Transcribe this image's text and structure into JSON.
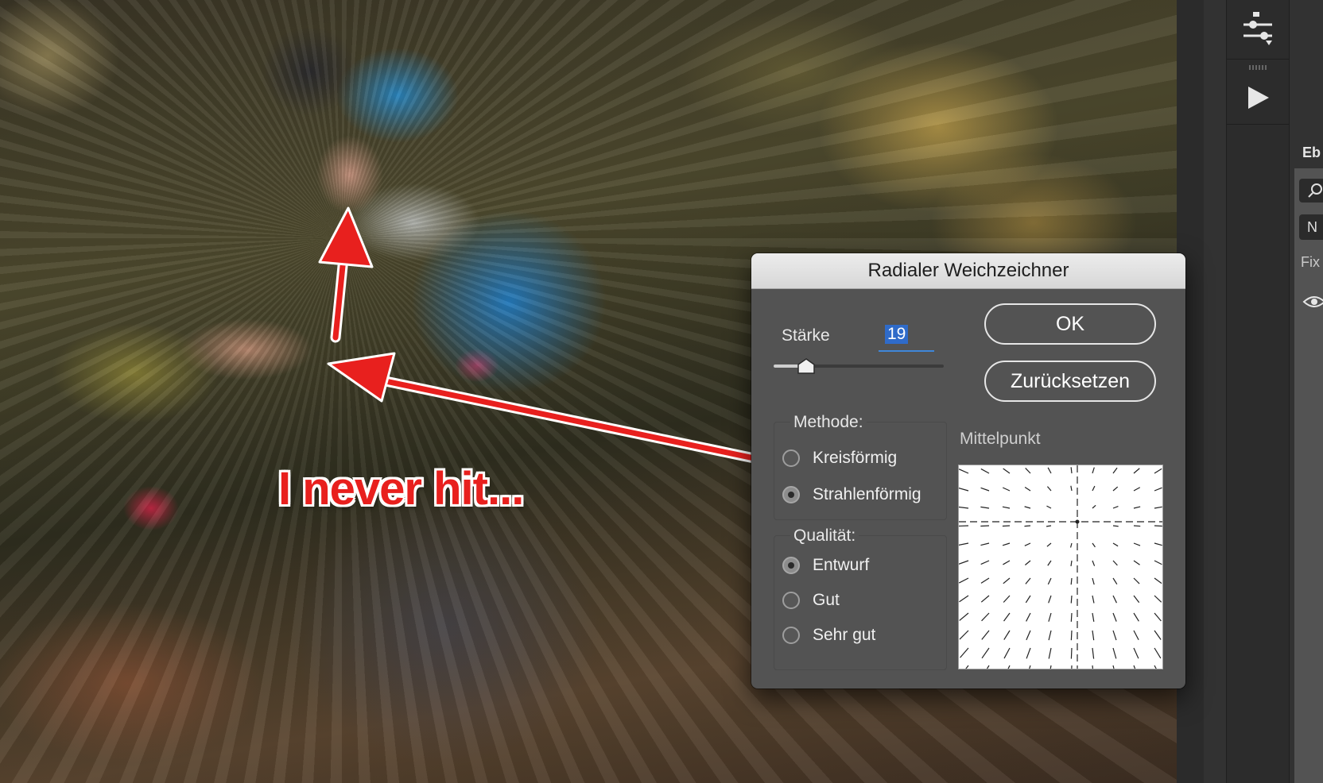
{
  "annotation": {
    "text": "I never hit...",
    "arrow_color": "#e8201e"
  },
  "dialog": {
    "title": "Radialer Weichzeichner",
    "strength": {
      "label": "Stärke",
      "value": "19",
      "slider_fraction": 0.19
    },
    "buttons": {
      "ok": "OK",
      "reset": "Zurücksetzen"
    },
    "method": {
      "title": "Methode:",
      "options": [
        {
          "label": "Kreisförmig",
          "checked": false
        },
        {
          "label": "Strahlenförmig",
          "checked": true
        }
      ]
    },
    "quality": {
      "title": "Qualität:",
      "options": [
        {
          "label": "Entwurf",
          "checked": true
        },
        {
          "label": "Gut",
          "checked": false
        },
        {
          "label": "Sehr gut",
          "checked": false
        }
      ]
    },
    "center": {
      "label": "Mittelpunkt"
    }
  },
  "panels": {
    "layers_tab_label": "Eb",
    "blend_mode_label": "N",
    "lock_label": "Fix",
    "icons": [
      "sliders-icon",
      "play-icon",
      "search-icon",
      "eye-icon"
    ]
  },
  "colors": {
    "accent": "#3f86d9",
    "selection": "#2f6bc9",
    "dialog_bg": "#535353",
    "panel_bg": "#323232"
  }
}
